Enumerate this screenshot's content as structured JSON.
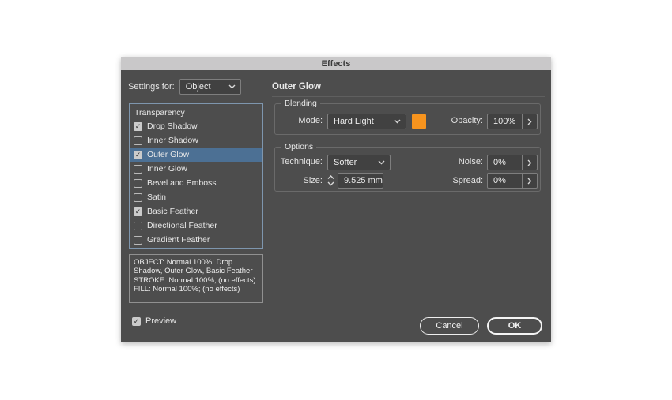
{
  "title_bar": {
    "title": "Effects"
  },
  "header": {
    "settings_for_label": "Settings for:",
    "settings_for_value": "Object",
    "panel_title": "Outer Glow"
  },
  "effects_list": {
    "header": "Transparency",
    "items": [
      {
        "label": "Drop Shadow",
        "checked": true,
        "selected": false
      },
      {
        "label": "Inner Shadow",
        "checked": false,
        "selected": false
      },
      {
        "label": "Outer Glow",
        "checked": true,
        "selected": true
      },
      {
        "label": "Inner Glow",
        "checked": false,
        "selected": false
      },
      {
        "label": "Bevel and Emboss",
        "checked": false,
        "selected": false
      },
      {
        "label": "Satin",
        "checked": false,
        "selected": false
      },
      {
        "label": "Basic Feather",
        "checked": true,
        "selected": false
      },
      {
        "label": "Directional Feather",
        "checked": false,
        "selected": false
      },
      {
        "label": "Gradient Feather",
        "checked": false,
        "selected": false
      }
    ]
  },
  "summary_box": {
    "lines": [
      "OBJECT: Normal 100%; Drop Shadow, Outer Glow, Basic Feather",
      "STROKE: Normal 100%; (no effects)",
      "FILL: Normal 100%; (no effects)"
    ]
  },
  "preview": {
    "label": "Preview",
    "checked": true
  },
  "blending": {
    "legend": "Blending",
    "mode_label": "Mode:",
    "mode_value": "Hard Light",
    "swatch_color": "#F7941E",
    "opacity_label": "Opacity:",
    "opacity_value": "100%"
  },
  "options": {
    "legend": "Options",
    "technique_label": "Technique:",
    "technique_value": "Softer",
    "noise_label": "Noise:",
    "noise_value": "0%",
    "size_label": "Size:",
    "size_value": "9.525 mm",
    "spread_label": "Spread:",
    "spread_value": "0%"
  },
  "actions": {
    "cancel_label": "Cancel",
    "ok_label": "OK"
  },
  "icons": {
    "check": "✓"
  },
  "colors": {
    "selection": "#4C7094",
    "list_border": "#7E96AE",
    "dialog_bg": "#4D4D4D",
    "titlebar_bg": "#C9C8C9",
    "swatch": "#F7941E"
  }
}
